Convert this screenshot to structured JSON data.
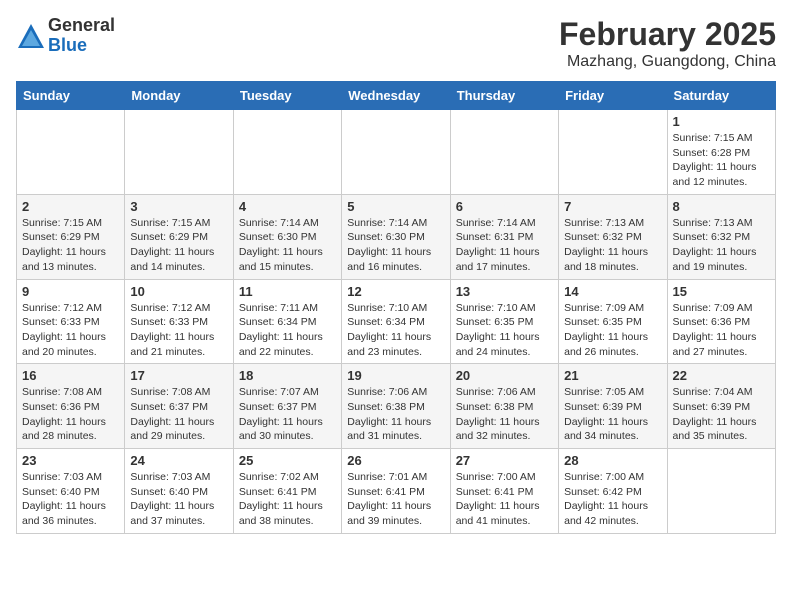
{
  "header": {
    "logo_general": "General",
    "logo_blue": "Blue",
    "month_title": "February 2025",
    "location": "Mazhang, Guangdong, China"
  },
  "days_of_week": [
    "Sunday",
    "Monday",
    "Tuesday",
    "Wednesday",
    "Thursday",
    "Friday",
    "Saturday"
  ],
  "weeks": [
    [
      {
        "day": "",
        "info": ""
      },
      {
        "day": "",
        "info": ""
      },
      {
        "day": "",
        "info": ""
      },
      {
        "day": "",
        "info": ""
      },
      {
        "day": "",
        "info": ""
      },
      {
        "day": "",
        "info": ""
      },
      {
        "day": "1",
        "info": "Sunrise: 7:15 AM\nSunset: 6:28 PM\nDaylight: 11 hours and 12 minutes."
      }
    ],
    [
      {
        "day": "2",
        "info": "Sunrise: 7:15 AM\nSunset: 6:29 PM\nDaylight: 11 hours and 13 minutes."
      },
      {
        "day": "3",
        "info": "Sunrise: 7:15 AM\nSunset: 6:29 PM\nDaylight: 11 hours and 14 minutes."
      },
      {
        "day": "4",
        "info": "Sunrise: 7:14 AM\nSunset: 6:30 PM\nDaylight: 11 hours and 15 minutes."
      },
      {
        "day": "5",
        "info": "Sunrise: 7:14 AM\nSunset: 6:30 PM\nDaylight: 11 hours and 16 minutes."
      },
      {
        "day": "6",
        "info": "Sunrise: 7:14 AM\nSunset: 6:31 PM\nDaylight: 11 hours and 17 minutes."
      },
      {
        "day": "7",
        "info": "Sunrise: 7:13 AM\nSunset: 6:32 PM\nDaylight: 11 hours and 18 minutes."
      },
      {
        "day": "8",
        "info": "Sunrise: 7:13 AM\nSunset: 6:32 PM\nDaylight: 11 hours and 19 minutes."
      }
    ],
    [
      {
        "day": "9",
        "info": "Sunrise: 7:12 AM\nSunset: 6:33 PM\nDaylight: 11 hours and 20 minutes."
      },
      {
        "day": "10",
        "info": "Sunrise: 7:12 AM\nSunset: 6:33 PM\nDaylight: 11 hours and 21 minutes."
      },
      {
        "day": "11",
        "info": "Sunrise: 7:11 AM\nSunset: 6:34 PM\nDaylight: 11 hours and 22 minutes."
      },
      {
        "day": "12",
        "info": "Sunrise: 7:10 AM\nSunset: 6:34 PM\nDaylight: 11 hours and 23 minutes."
      },
      {
        "day": "13",
        "info": "Sunrise: 7:10 AM\nSunset: 6:35 PM\nDaylight: 11 hours and 24 minutes."
      },
      {
        "day": "14",
        "info": "Sunrise: 7:09 AM\nSunset: 6:35 PM\nDaylight: 11 hours and 26 minutes."
      },
      {
        "day": "15",
        "info": "Sunrise: 7:09 AM\nSunset: 6:36 PM\nDaylight: 11 hours and 27 minutes."
      }
    ],
    [
      {
        "day": "16",
        "info": "Sunrise: 7:08 AM\nSunset: 6:36 PM\nDaylight: 11 hours and 28 minutes."
      },
      {
        "day": "17",
        "info": "Sunrise: 7:08 AM\nSunset: 6:37 PM\nDaylight: 11 hours and 29 minutes."
      },
      {
        "day": "18",
        "info": "Sunrise: 7:07 AM\nSunset: 6:37 PM\nDaylight: 11 hours and 30 minutes."
      },
      {
        "day": "19",
        "info": "Sunrise: 7:06 AM\nSunset: 6:38 PM\nDaylight: 11 hours and 31 minutes."
      },
      {
        "day": "20",
        "info": "Sunrise: 7:06 AM\nSunset: 6:38 PM\nDaylight: 11 hours and 32 minutes."
      },
      {
        "day": "21",
        "info": "Sunrise: 7:05 AM\nSunset: 6:39 PM\nDaylight: 11 hours and 34 minutes."
      },
      {
        "day": "22",
        "info": "Sunrise: 7:04 AM\nSunset: 6:39 PM\nDaylight: 11 hours and 35 minutes."
      }
    ],
    [
      {
        "day": "23",
        "info": "Sunrise: 7:03 AM\nSunset: 6:40 PM\nDaylight: 11 hours and 36 minutes."
      },
      {
        "day": "24",
        "info": "Sunrise: 7:03 AM\nSunset: 6:40 PM\nDaylight: 11 hours and 37 minutes."
      },
      {
        "day": "25",
        "info": "Sunrise: 7:02 AM\nSunset: 6:41 PM\nDaylight: 11 hours and 38 minutes."
      },
      {
        "day": "26",
        "info": "Sunrise: 7:01 AM\nSunset: 6:41 PM\nDaylight: 11 hours and 39 minutes."
      },
      {
        "day": "27",
        "info": "Sunrise: 7:00 AM\nSunset: 6:41 PM\nDaylight: 11 hours and 41 minutes."
      },
      {
        "day": "28",
        "info": "Sunrise: 7:00 AM\nSunset: 6:42 PM\nDaylight: 11 hours and 42 minutes."
      },
      {
        "day": "",
        "info": ""
      }
    ]
  ]
}
